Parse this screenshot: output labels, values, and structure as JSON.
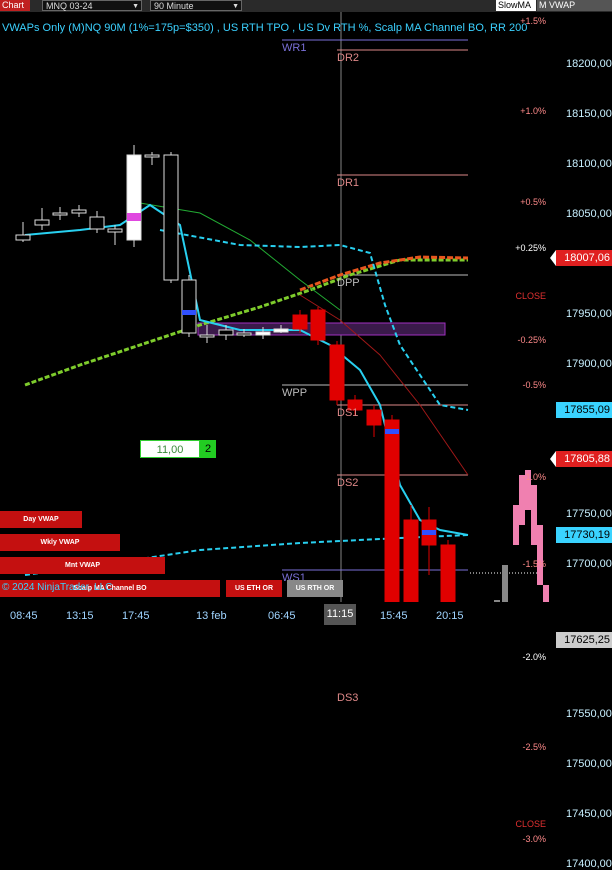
{
  "toolbar": {
    "chart_label": "Chart",
    "instrument": "MNQ 03-24",
    "interval": "90 Minute",
    "tab_vwap": "VWAP",
    "tab_slowma": "SlowMA",
    "tab_vwap2": "M VWAP"
  },
  "indicator_title": "VWAPs Only (M)NQ 90M  (1%=175p=$350) , US RTH TPO , US Dv RTH %, Scalp MA Channel BO, RR 200",
  "chart_data": {
    "type": "candlestick",
    "y_ticks": [
      "18200,00",
      "18150,00",
      "18100,00",
      "18050,00",
      "17950,00",
      "17900,00",
      "17750,00",
      "17700,00",
      "17550,00",
      "17500,00",
      "17450,00",
      "17400,00"
    ],
    "x_ticks": [
      "08:45",
      "13:15",
      "17:45",
      "13 feb",
      "06:45",
      "15:45",
      "20:15"
    ],
    "current_time": "11:15",
    "ylim": [
      17383,
      18230
    ],
    "price_tags": [
      {
        "value": "18007,06",
        "price": 18007.06,
        "color": "#e02020"
      },
      {
        "value": "17855,09",
        "price": 17855.09,
        "color": "#3ad3ff"
      },
      {
        "value": "17805,88",
        "price": 17805.88,
        "color": "#e02020"
      },
      {
        "value": "17730,19",
        "price": 17730.19,
        "color": "#3ad3ff"
      },
      {
        "value": "17625,25",
        "price": 17625.25,
        "color": "#cccccc"
      }
    ],
    "pivots": [
      {
        "label": "WR1",
        "price": 18225,
        "color": "#7a70d8"
      },
      {
        "label": "DR2",
        "price": 18215,
        "color": "#d88"
      },
      {
        "label": "DR1",
        "price": 18090,
        "color": "#d88"
      },
      {
        "label": "DPP",
        "price": 17990,
        "color": "#bbb"
      },
      {
        "label": "WPP",
        "price": 17880,
        "color": "#bbb"
      },
      {
        "label": "DS1",
        "price": 17860,
        "color": "#d88"
      },
      {
        "label": "DS2",
        "price": 17790,
        "color": "#d88"
      },
      {
        "label": "WS1",
        "price": 17695,
        "color": "#7a70d8"
      },
      {
        "label": "DS3",
        "price": 17575,
        "color": "#d88"
      }
    ],
    "percent_levels": [
      {
        "label": "+1.5%",
        "price": 18243,
        "color": "#ff8a8a"
      },
      {
        "label": "+1.0%",
        "price": 18153,
        "color": "#ff8a8a"
      },
      {
        "label": "+0.5%",
        "price": 18062,
        "color": "#ff8a8a"
      },
      {
        "label": "+0.25%",
        "price": 18016,
        "color": "#fff"
      },
      {
        "label": "CLOSE",
        "price": 17968,
        "color": "#e03030"
      },
      {
        "label": "-0.25%",
        "price": 17924,
        "color": "#ff8a8a"
      },
      {
        "label": "-0.5%",
        "price": 17879,
        "color": "#ff8a8a"
      },
      {
        "label": "-1.0%",
        "price": 17787,
        "color": "#ff8a8a"
      },
      {
        "label": "-1.5%",
        "price": 17700,
        "color": "#ff8a8a"
      },
      {
        "label": "-2.0%",
        "price": 17607,
        "color": "#fff"
      },
      {
        "label": "-2.5%",
        "price": 17517,
        "color": "#ff8a8a"
      },
      {
        "label": "CLOSE",
        "price": 17440,
        "color": "#e03030"
      },
      {
        "label": "-3.0%",
        "price": 17425,
        "color": "#ff8a8a"
      }
    ],
    "candles": [
      {
        "x": 23,
        "o": 18030,
        "h": 18043,
        "c": 18025,
        "l": 18023
      },
      {
        "x": 42,
        "o": 18045,
        "h": 18057,
        "c": 18040,
        "l": 18035
      },
      {
        "x": 60,
        "o": 18052,
        "h": 18058,
        "c": 18050,
        "l": 18045
      },
      {
        "x": 79,
        "o": 18055,
        "h": 18060,
        "c": 18052,
        "l": 18048
      },
      {
        "x": 97,
        "o": 18048,
        "h": 18054,
        "c": 18036,
        "l": 18032
      },
      {
        "x": 115,
        "o": 18036,
        "h": 18040,
        "c": 18033,
        "l": 18020
      },
      {
        "x": 134,
        "o": 18025,
        "h": 18120,
        "c": 18110,
        "l": 18018
      },
      {
        "x": 152,
        "o": 18110,
        "h": 18113,
        "c": 18108,
        "l": 18100
      },
      {
        "x": 171,
        "o": 18110,
        "h": 18113,
        "c": 17985,
        "l": 17982
      },
      {
        "x": 189,
        "o": 17985,
        "h": 17990,
        "c": 17932,
        "l": 17928
      },
      {
        "x": 207,
        "o": 17930,
        "h": 17940,
        "c": 17928,
        "l": 17922
      },
      {
        "x": 226,
        "o": 17935,
        "h": 17940,
        "c": 17930,
        "l": 17925
      },
      {
        "x": 244,
        "o": 17932,
        "h": 17936,
        "c": 17930,
        "l": 17928
      },
      {
        "x": 263,
        "o": 17930,
        "h": 17938,
        "c": 17933,
        "l": 17926
      },
      {
        "x": 281,
        "o": 17933,
        "h": 17940,
        "c": 17936,
        "l": 17932
      },
      {
        "x": 300,
        "o": 17936,
        "h": 17955,
        "c": 17950,
        "l": 17932
      },
      {
        "x": 318,
        "o": 17955,
        "h": 17958,
        "c": 17925,
        "l": 17920
      },
      {
        "x": 337,
        "o": 17920,
        "h": 17924,
        "c": 17865,
        "l": 17860
      },
      {
        "x": 355,
        "o": 17865,
        "h": 17870,
        "c": 17855,
        "l": 17850
      },
      {
        "x": 374,
        "o": 17855,
        "h": 17860,
        "c": 17840,
        "l": 17828
      },
      {
        "x": 392,
        "o": 17845,
        "h": 17850,
        "c": 17630,
        "l": 17620
      },
      {
        "x": 411,
        "o": 17630,
        "h": 17760,
        "c": 17745,
        "l": 17620
      },
      {
        "x": 429,
        "o": 17745,
        "h": 17758,
        "c": 17720,
        "l": 17690
      },
      {
        "x": 448,
        "o": 17720,
        "h": 17725,
        "c": 17598,
        "l": 17590
      },
      {
        "x": 466,
        "o": 17598,
        "h": 17605,
        "c": 17598,
        "l": 17592
      }
    ],
    "crosshair": {
      "price": "11,00",
      "badge": "2"
    }
  },
  "buttons": [
    {
      "label": "Day VWAP",
      "color": "#c41010"
    },
    {
      "label": "Wkly VWAP",
      "color": "#c41010"
    },
    {
      "label": "Mnt VWAP",
      "color": "#c41010"
    },
    {
      "label": "Scalp MA Channel BO",
      "color": "#c41010"
    },
    {
      "label": "US ETH OR",
      "color": "#c41010"
    },
    {
      "label": "US RTH OR",
      "color": "#888"
    }
  ],
  "copyright": "© 2024 NinjaTrader, LLC"
}
